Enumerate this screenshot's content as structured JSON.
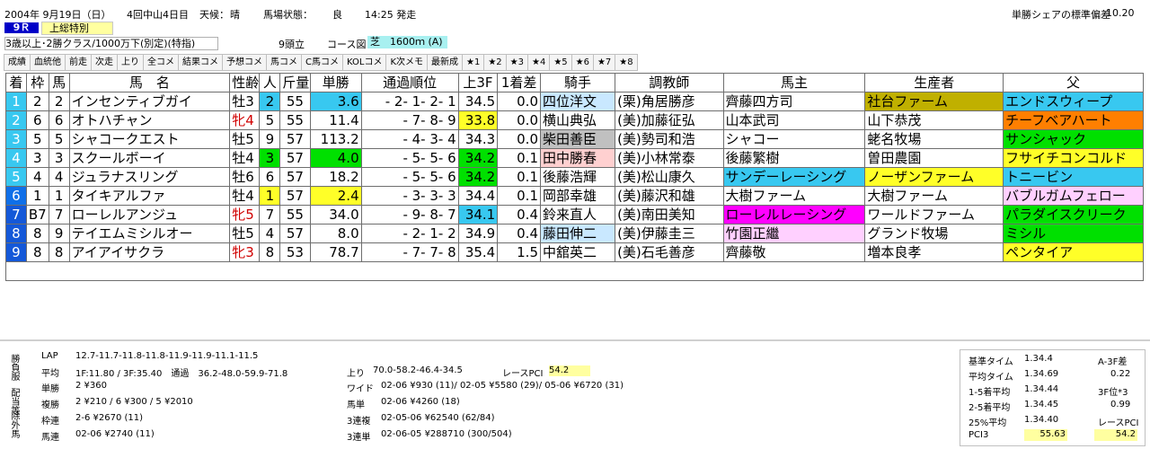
{
  "header": {
    "date": "2004年 9月19日（日）",
    "meeting": "4回中山4日目",
    "weather_label": "天候：",
    "weather": "晴",
    "track_label": "馬場状態：",
    "track": "良",
    "start_time": "14:25 発走",
    "share_label": "単勝シェアの標準偏差",
    "share_value": "10.20",
    "race_no": "9Ｒ",
    "race_name": "上総特別",
    "conditions": "3歳以上･2勝クラス/1000万下(別定)(特指)",
    "heads": "9頭立",
    "course_label": "コース図",
    "course": "芝　1600ｍ (A)"
  },
  "tabs": [
    "成績",
    "血統他",
    "前走",
    "次走",
    "上り",
    "全コメ",
    "結果コメ",
    "予想コメ",
    "馬コメ",
    "C馬コメ",
    "KOLコメ",
    "K次メモ",
    "最新成",
    "★1",
    "★2",
    "★3",
    "★4",
    "★5",
    "★6",
    "★7",
    "★8"
  ],
  "columns": [
    "着",
    "枠",
    "馬",
    "馬　名",
    "性齢",
    "人",
    "斤量",
    "単勝",
    "通過順位",
    "上3F",
    "1着差",
    "騎手",
    "調教師",
    "馬主",
    "生産者",
    "父"
  ],
  "rows": [
    {
      "pos": "1",
      "waku": "2",
      "num": "2",
      "name": "インセンティブガイ",
      "sexage": "牡3",
      "pop": "2",
      "kin": "55",
      "odds": "3.6",
      "passage": "- 2- 1- 2- 1",
      "f3": "34.5",
      "diff": "0.0",
      "jockey": "四位洋文",
      "trainer": "(栗)角居勝彦",
      "owner": "齊藤四方司",
      "breeder": "社台ファーム",
      "sire": "エンドスウィープ"
    },
    {
      "pos": "2",
      "waku": "6",
      "num": "6",
      "name": "オトハチャン",
      "sexage": "牝4",
      "pop": "5",
      "kin": "55",
      "odds": "11.4",
      "passage": "- 7- 8- 9",
      "f3": "33.8",
      "diff": "0.0",
      "jockey": "横山典弘",
      "trainer": "(美)加藤征弘",
      "owner": "山本武司",
      "breeder": "山下恭茂",
      "sire": "チーフベアハート"
    },
    {
      "pos": "3",
      "waku": "5",
      "num": "5",
      "name": "シャコークエスト",
      "sexage": "牡5",
      "pop": "9",
      "kin": "57",
      "odds": "113.2",
      "passage": "- 4- 3- 4",
      "f3": "34.3",
      "diff": "0.0",
      "jockey": "柴田善臣",
      "trainer": "(美)勢司和浩",
      "owner": "シャコー",
      "breeder": "蛯名牧場",
      "sire": "サンシャック"
    },
    {
      "pos": "4",
      "waku": "3",
      "num": "3",
      "name": "スクールボーイ",
      "sexage": "牡4",
      "pop": "3",
      "kin": "57",
      "odds": "4.0",
      "passage": "- 5- 5- 6",
      "f3": "34.2",
      "diff": "0.1",
      "jockey": "田中勝春",
      "trainer": "(美)小林常泰",
      "owner": "後藤繁樹",
      "breeder": "曽田農園",
      "sire": "フサイチコンコルド"
    },
    {
      "pos": "5",
      "waku": "4",
      "num": "4",
      "name": "ジュラナスリング",
      "sexage": "牡6",
      "pop": "6",
      "kin": "57",
      "odds": "18.2",
      "passage": "- 5- 5- 6",
      "f3": "34.2",
      "diff": "0.1",
      "jockey": "後藤浩輝",
      "trainer": "(美)松山康久",
      "owner": "サンデーレーシング",
      "breeder": "ノーザンファーム",
      "sire": "トニービン"
    },
    {
      "pos": "6",
      "waku": "1",
      "num": "1",
      "name": "タイキアルファ",
      "sexage": "牡4",
      "pop": "1",
      "kin": "57",
      "odds": "2.4",
      "passage": "- 3- 3- 3",
      "f3": "34.4",
      "diff": "0.1",
      "jockey": "岡部幸雄",
      "trainer": "(美)藤沢和雄",
      "owner": "大樹ファーム",
      "breeder": "大樹ファーム",
      "sire": "バブルガムフェロー"
    },
    {
      "pos": "7",
      "waku": "B7",
      "num": "7",
      "name": "ローレルアンジュ",
      "sexage": "牝5",
      "pop": "7",
      "kin": "55",
      "odds": "34.0",
      "passage": "- 9- 8- 7",
      "f3": "34.1",
      "diff": "0.4",
      "jockey": "鈴来直人",
      "trainer": "(美)南田美知",
      "owner": "ローレルレーシング",
      "breeder": "ワールドファーム",
      "sire": "パラダイスクリーク"
    },
    {
      "pos": "8",
      "waku": "8",
      "num": "9",
      "name": "テイエムミシルオー",
      "sexage": "牡5",
      "pop": "4",
      "kin": "57",
      "odds": "8.0",
      "passage": "- 2- 1- 2",
      "f3": "34.9",
      "diff": "0.4",
      "jockey": "藤田伸二",
      "trainer": "(美)伊藤圭三",
      "owner": "竹園正繼",
      "breeder": "グランド牧場",
      "sire": "ミシル"
    },
    {
      "pos": "9",
      "waku": "8",
      "num": "8",
      "name": "アイアイサクラ",
      "sexage": "牝3",
      "pop": "8",
      "kin": "53",
      "odds": "78.7",
      "passage": "- 7- 7- 8",
      "f3": "35.4",
      "diff": "1.5",
      "jockey": "中舘英二",
      "trainer": "(美)石毛善彦",
      "owner": "齊藤敬",
      "breeder": "増本良孝",
      "sire": "ペンタイア"
    }
  ],
  "bottom": {
    "side1": "勝負服",
    "side2": "配当等",
    "side3": "除外馬",
    "lap_label": "LAP",
    "lap": "12.7-11.7-11.8-11.8-11.9-11.9-11.1-11.5",
    "avg_label": "平均",
    "avg": "1F:11.80 / 3F:35.40　通過　36.2-48.0-59.9-71.8",
    "agari_label": "上り",
    "agari": "70.0-58.2-46.4-34.5",
    "race_pci_label": "レースPCI",
    "race_pci": "54.2",
    "tansho_label": "単勝",
    "tansho": "2 ¥360",
    "fukusho_label": "複勝",
    "fukusho": "2 ¥210 / 6 ¥300 / 5 ¥2010",
    "wakuren_label": "枠連",
    "wakuren": "2-6 ¥2670 (11)",
    "umaren_label": "馬連",
    "umaren": "02-06 ¥2740 (11)",
    "wide_label": "ワイド",
    "wide": "02-06 ¥930 (11)/ 02-05 ¥5580 (29)/ 05-06 ¥6720 (31)",
    "umatan_label": "馬単",
    "umatan": "02-06 ¥4260 (18)",
    "sanrenpuku_label": "3連複",
    "sanrenpuku": "02-05-06 ¥62540 (62/84)",
    "sanrentan_label": "3連単",
    "sanrentan": "02-06-05 ¥288710 (300/504)"
  },
  "panel": {
    "base_time_label": "基準タイム",
    "base_time": "1.34.4",
    "a3f_label": "A-3F差",
    "avg_time_label": "平均タイム",
    "avg_time": "1.34.69",
    "a3f_value": "0.22",
    "avg15_label": "1-5着平均",
    "avg15": "1.34.44",
    "f3rank_label": "3F位*3",
    "avg25_label": "2-5着平均",
    "avg25": "1.34.45",
    "f3rank_value": "0.99",
    "p25_label": "25%平均",
    "p25": "1.34.40",
    "race_pci_label": "レースPCI",
    "pci3_label": "PCI3",
    "pci3": "55.63",
    "race_pci": "54.2"
  }
}
